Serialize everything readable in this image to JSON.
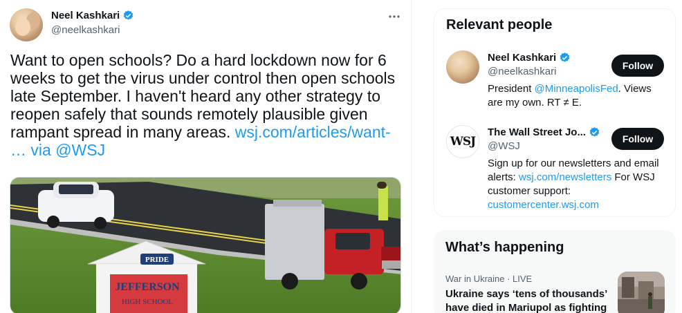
{
  "tweet": {
    "author_name": "Neel Kashkari",
    "author_handle": "@neelkashkari",
    "more_icon": "more-dots-icon",
    "text_lines": {
      "l1": "Want to open schools? Do a hard lockdown now for 6",
      "l2": "weeks to get the virus under control then open schools",
      "l3": "late September. I haven't heard any other strategy to",
      "l4": "reopen safely that sounds remotely plausible given",
      "l5_prefix": "rampant spread in many areas. ",
      "link": "wsj.com/articles/want-",
      "l6_prefix": "… via ",
      "mention": "@WSJ"
    },
    "media": {
      "sign_top": "PRIDE",
      "sign_line1": "JEFFERSON",
      "sign_line2": "HIGH SCHOOL"
    }
  },
  "relevant_people": {
    "title": "Relevant people",
    "people": [
      {
        "name": "Neel Kashkari",
        "handle": "@neelkashkari",
        "follow_label": "Follow",
        "bio_prefix": "President ",
        "bio_mention": "@MinneapolisFed",
        "bio_suffix": ". Views are my own. RT ≠ E."
      },
      {
        "name": "The Wall Street Jo...",
        "handle": "@WSJ",
        "avatar_text": "WSJ",
        "follow_label": "Follow",
        "bio_prefix": "Sign up for our newsletters and email alerts: ",
        "bio_link1": "wsj.com/newsletters",
        "bio_middle": " For WSJ customer support: ",
        "bio_link2": "customercenter.wsj.com"
      }
    ]
  },
  "whats_happening": {
    "title": "What’s happening",
    "trend": {
      "meta": "War in Ukraine · LIVE",
      "title": "Ukraine says ‘tens of thousands’ have died in Mariupol as fighting"
    }
  },
  "colors": {
    "link": "#1d9bf0",
    "text": "#0f1419",
    "muted": "#536471",
    "button": "#0f1419"
  }
}
